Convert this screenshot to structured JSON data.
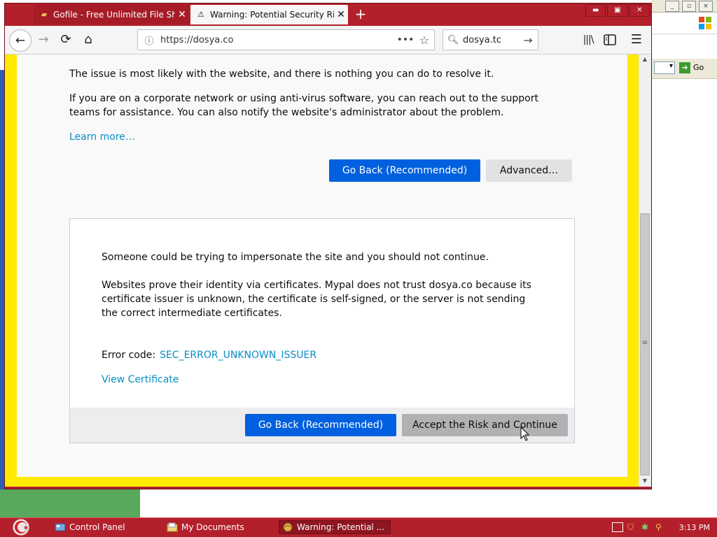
{
  "background_app": {
    "go_label": "Go",
    "window_controls": [
      "_",
      "▫",
      "×"
    ]
  },
  "browser": {
    "tabs": [
      {
        "title": "Gofile - Free Unlimited File Sha",
        "active": false
      },
      {
        "title": "Warning: Potential Security Ris",
        "active": true
      }
    ],
    "new_tab": "+",
    "window_controls": [
      "▬",
      "▣",
      "✕"
    ],
    "nav": {
      "back": "←",
      "forward": "→",
      "reload": "⟳",
      "home": "⌂"
    },
    "url": "https://dosya.co",
    "url_more": "•••",
    "search_query": "dosya.tc",
    "menu": "☰"
  },
  "page": {
    "intro_text": "The issue is most likely with the website, and there is nothing you can do to resolve it.",
    "corporate_text": "If you are on a corporate network or using anti-virus software, you can reach out to the support teams for assistance. You can also notify the website's administrator about the problem.",
    "learn_more": "Learn more…",
    "go_back_label": "Go Back (Recommended)",
    "advanced_label": "Advanced…",
    "advanced_panel": {
      "impersonate_text": "Someone could be trying to impersonate the site and you should not continue.",
      "cert_text": "Websites prove their identity via certificates. Mypal does not trust dosya.co because its certificate issuer is unknown, the certificate is self-signed, or the server is not sending the correct intermediate certificates.",
      "error_code_label": "Error code:",
      "error_code": "SEC_ERROR_UNKNOWN_ISSUER",
      "view_certificate": "View Certificate",
      "go_back_label": "Go Back (Recommended)",
      "accept_label": "Accept the Risk and Continue"
    }
  },
  "taskbar": {
    "items": [
      {
        "label": "Control Panel"
      },
      {
        "label": "My Documents"
      },
      {
        "label": "Warning: Potential ..."
      }
    ],
    "clock": "3:13 PM"
  },
  "colors": {
    "window_frame": "#b3202c",
    "primary_button": "#0060df",
    "link": "#0a8dc4",
    "highlight_border": "#ffea00"
  }
}
